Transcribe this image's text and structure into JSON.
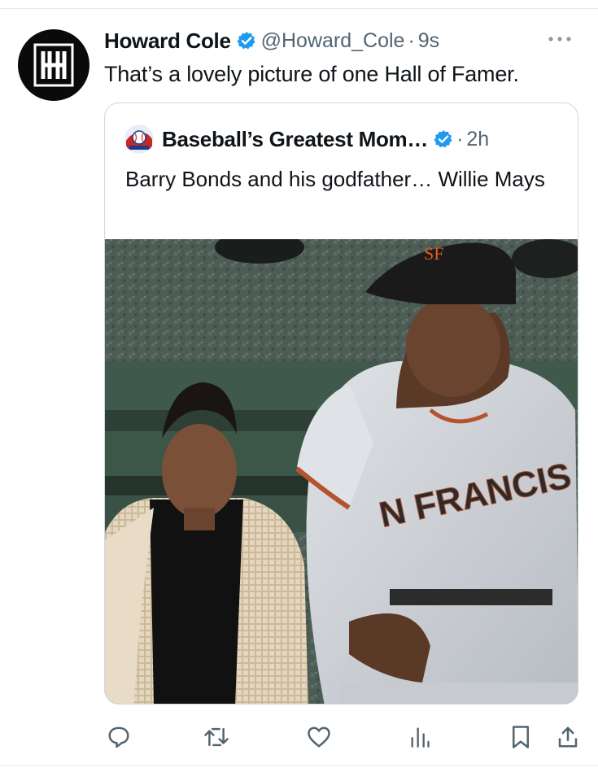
{
  "tweet": {
    "author": {
      "name": "Howard Cole",
      "handle": "@Howard_Cole",
      "avatar_letter": "H",
      "verified": true
    },
    "separator": "·",
    "time": "9s",
    "text": "That’s a lovely picture of one Hall of Famer."
  },
  "quoted": {
    "author": {
      "name": "Baseball’s Greatest Mom…",
      "verified": true
    },
    "separator": "·",
    "time": "2h",
    "text": "Barry Bonds and his godfather… Willie Mays",
    "media": {
      "description_icon": "photo",
      "jersey_text": "N FRANCIS",
      "cap_logo": "SF"
    }
  },
  "actions": [
    {
      "name": "reply",
      "icon": "reply-icon"
    },
    {
      "name": "retweet",
      "icon": "retweet-icon"
    },
    {
      "name": "like",
      "icon": "heart-icon"
    },
    {
      "name": "views",
      "icon": "views-icon"
    },
    {
      "name": "bookmark",
      "icon": "bookmark-icon"
    },
    {
      "name": "share",
      "icon": "share-icon"
    }
  ],
  "colors": {
    "verified": "#1d9bf0",
    "secondary_text": "#536471",
    "action_icon": "#536471",
    "border": "#cfd9de"
  }
}
